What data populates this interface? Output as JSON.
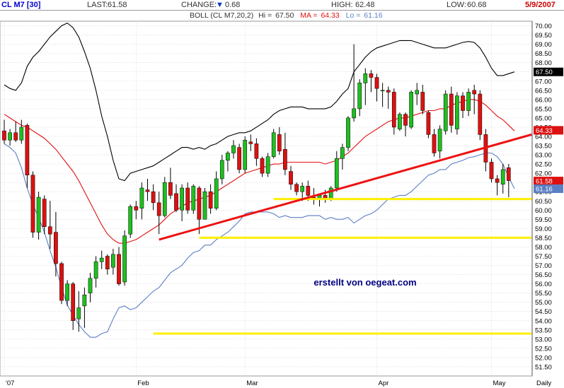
{
  "header": {
    "symbol": "CL M7 [30]",
    "last_label": "LAST:",
    "last_value": "61.58",
    "change_label": "CHANGE:",
    "change_value": "0.68",
    "high_label": "HIGH:",
    "high_value": "62.48",
    "low_label": "LOW:",
    "low_value": "60.68",
    "date": "5/9/2007"
  },
  "legend": {
    "indicator": "BOLL (CL M7,20,2)",
    "hi_label": "Hi =",
    "hi_value": "67.50",
    "ma_label": "MA =",
    "ma_value": "64.33",
    "lo_label": "Lo =",
    "lo_value": "61.16"
  },
  "colors": {
    "up": "#1fbf1f",
    "down": "#dd1111",
    "ma": "#e01010",
    "upper_band": "#000000",
    "lower_band": "#5b7fc4",
    "trendline": "#ee1111",
    "support": "#ffee00",
    "grid": "#c8c8c8",
    "annotation": "#000080"
  },
  "chart_data": {
    "type": "candlestick",
    "y_range": [
      51.0,
      70.25
    ],
    "y_ticks": [
      "51.50",
      "52.00",
      "52.50",
      "53.00",
      "53.50",
      "54.00",
      "54.50",
      "55.00",
      "55.50",
      "56.00",
      "56.50",
      "57.00",
      "57.50",
      "58.00",
      "58.50",
      "59.00",
      "59.50",
      "60.00",
      "60.50",
      "61.00",
      "61.50",
      "62.00",
      "62.50",
      "63.00",
      "63.50",
      "64.00",
      "64.50",
      "65.00",
      "65.50",
      "66.00",
      "66.50",
      "67.00",
      "67.50",
      "68.00",
      "68.50",
      "69.00",
      "69.50",
      "70.00"
    ],
    "x_ticks": [
      "'07",
      "Feb",
      "Mar",
      "Apr",
      "May"
    ],
    "x_axis_label": "Daily",
    "x_tick_positions": [
      0,
      23,
      42,
      65,
      85
    ],
    "candles": [
      [
        64.3,
        64.9,
        63.6,
        63.8
      ],
      [
        63.8,
        64.4,
        63.5,
        64.2
      ],
      [
        64.2,
        64.8,
        63.7,
        63.8
      ],
      [
        63.8,
        64.9,
        63.6,
        64.5
      ],
      [
        64.6,
        64.7,
        61.2,
        61.9
      ],
      [
        61.9,
        62.1,
        58.5,
        58.8
      ],
      [
        58.8,
        61.0,
        58.4,
        60.7
      ],
      [
        60.6,
        60.8,
        58.7,
        59.1
      ],
      [
        59.1,
        60.5,
        57.9,
        58.7
      ],
      [
        58.8,
        59.9,
        56.4,
        57.1
      ],
      [
        57.1,
        57.2,
        54.9,
        55.1
      ],
      [
        55.1,
        56.2,
        54.8,
        56.0
      ],
      [
        56.0,
        56.1,
        53.5,
        54.0
      ],
      [
        54.1,
        55.6,
        53.4,
        54.7
      ],
      [
        54.8,
        55.8,
        53.6,
        55.4
      ],
      [
        55.5,
        56.6,
        55.0,
        56.3
      ],
      [
        56.3,
        57.5,
        55.8,
        57.2
      ],
      [
        57.2,
        57.8,
        56.8,
        57.4
      ],
      [
        57.5,
        57.6,
        56.5,
        56.8
      ],
      [
        56.9,
        57.9,
        56.5,
        57.6
      ],
      [
        57.6,
        58.0,
        55.9,
        56.0
      ],
      [
        56.1,
        58.9,
        55.9,
        58.6
      ],
      [
        58.7,
        60.3,
        58.5,
        60.2
      ],
      [
        60.2,
        60.5,
        59.5,
        60.0
      ],
      [
        60.1,
        61.5,
        59.5,
        61.2
      ],
      [
        61.1,
        61.7,
        60.5,
        61.0
      ],
      [
        61.0,
        61.4,
        60.0,
        60.4
      ],
      [
        60.4,
        61.0,
        58.7,
        59.7
      ],
      [
        59.7,
        61.8,
        59.6,
        61.5
      ],
      [
        61.5,
        62.3,
        60.6,
        60.8
      ],
      [
        60.9,
        61.4,
        59.9,
        60.0
      ],
      [
        60.0,
        61.4,
        59.4,
        61.2
      ],
      [
        61.2,
        61.5,
        59.8,
        60.0
      ],
      [
        60.0,
        61.4,
        59.8,
        61.3
      ],
      [
        61.2,
        61.3,
        58.7,
        59.5
      ],
      [
        59.5,
        61.2,
        59.5,
        61.0
      ],
      [
        61.0,
        61.4,
        59.8,
        60.1
      ],
      [
        60.1,
        62.1,
        60.0,
        61.7
      ],
      [
        61.7,
        63.0,
        61.4,
        62.7
      ],
      [
        62.7,
        63.2,
        62.1,
        63.1
      ],
      [
        63.1,
        63.8,
        62.8,
        63.5
      ],
      [
        63.4,
        63.6,
        62.0,
        62.2
      ],
      [
        62.2,
        64.0,
        62.0,
        63.8
      ],
      [
        63.7,
        64.1,
        63.2,
        63.6
      ],
      [
        63.6,
        63.9,
        62.4,
        62.8
      ],
      [
        62.8,
        62.9,
        61.8,
        62.0
      ],
      [
        62.0,
        63.1,
        61.8,
        62.9
      ],
      [
        62.9,
        64.4,
        62.8,
        64.2
      ],
      [
        64.1,
        64.5,
        63.0,
        63.2
      ],
      [
        63.3,
        64.2,
        61.9,
        62.2
      ],
      [
        62.1,
        62.4,
        61.1,
        61.4
      ],
      [
        61.4,
        61.5,
        60.8,
        61.0
      ],
      [
        61.0,
        61.5,
        60.5,
        61.3
      ],
      [
        61.3,
        61.6,
        60.5,
        60.8
      ],
      [
        60.7,
        61.2,
        60.3,
        60.6
      ],
      [
        60.6,
        60.9,
        60.2,
        60.8
      ],
      [
        60.8,
        61.1,
        60.4,
        60.6
      ],
      [
        60.6,
        61.3,
        60.5,
        61.2
      ],
      [
        61.2,
        63.2,
        61.0,
        62.8
      ],
      [
        62.8,
        63.6,
        62.2,
        63.4
      ],
      [
        63.4,
        65.1,
        63.2,
        65.0
      ],
      [
        65.0,
        69.0,
        64.8,
        65.5
      ],
      [
        65.5,
        67.1,
        65.1,
        66.9
      ],
      [
        66.9,
        67.7,
        65.7,
        67.4
      ],
      [
        67.4,
        67.6,
        66.4,
        67.2
      ],
      [
        67.2,
        67.4,
        65.9,
        66.6
      ],
      [
        66.5,
        66.9,
        65.6,
        66.5
      ],
      [
        66.5,
        66.7,
        65.5,
        66.4
      ],
      [
        66.4,
        66.6,
        64.1,
        64.5
      ],
      [
        64.4,
        65.3,
        64.3,
        65.2
      ],
      [
        65.2,
        65.3,
        64.0,
        64.6
      ],
      [
        64.5,
        66.5,
        64.4,
        66.4
      ],
      [
        66.3,
        66.9,
        65.7,
        66.5
      ],
      [
        66.4,
        66.8,
        65.2,
        65.4
      ],
      [
        65.3,
        65.4,
        63.9,
        64.1
      ],
      [
        64.1,
        64.4,
        62.9,
        63.1
      ],
      [
        63.2,
        64.6,
        62.8,
        64.4
      ],
      [
        64.3,
        66.5,
        64.1,
        66.3
      ],
      [
        66.3,
        66.7,
        64.2,
        64.6
      ],
      [
        64.4,
        66.4,
        64.1,
        66.2
      ],
      [
        66.2,
        66.4,
        65.0,
        65.4
      ],
      [
        65.4,
        66.6,
        65.1,
        66.4
      ],
      [
        66.5,
        66.8,
        65.2,
        66.3
      ],
      [
        66.3,
        66.5,
        63.8,
        64.1
      ],
      [
        64.1,
        64.4,
        62.1,
        62.6
      ],
      [
        62.6,
        62.8,
        61.5,
        61.7
      ],
      [
        61.7,
        61.9,
        60.8,
        61.5
      ],
      [
        61.4,
        62.5,
        60.9,
        62.2
      ],
      [
        62.3,
        62.5,
        60.7,
        61.6
      ]
    ],
    "upper_band": [
      66.8,
      66.6,
      66.5,
      66.9,
      67.8,
      68.3,
      68.6,
      69.0,
      69.4,
      69.7,
      70.0,
      70.15,
      69.9,
      69.4,
      68.6,
      67.7,
      66.5,
      65.1,
      64.0,
      62.7,
      61.7,
      61.6,
      62.0,
      62.1,
      62.2,
      62.3,
      62.4,
      62.6,
      62.8,
      63.0,
      63.2,
      63.4,
      63.4,
      63.3,
      63.4,
      63.3,
      63.5,
      63.6,
      63.8,
      64.0,
      64.1,
      64.2,
      64.2,
      64.3,
      64.5,
      64.7,
      64.9,
      65.2,
      65.4,
      65.5,
      65.6,
      65.6,
      65.6,
      65.5,
      65.5,
      65.5,
      65.5,
      65.6,
      65.9,
      66.3,
      66.6,
      67.5,
      67.9,
      68.3,
      68.6,
      68.8,
      68.9,
      69.0,
      69.1,
      69.2,
      69.2,
      69.2,
      69.1,
      69.0,
      68.9,
      68.8,
      68.8,
      68.8,
      68.9,
      69.0,
      69.1,
      69.15,
      69.1,
      68.8,
      68.3,
      67.7,
      67.3,
      67.3,
      67.4,
      67.5
    ],
    "ma": [
      65.2,
      65.0,
      64.8,
      64.6,
      64.5,
      64.3,
      64.1,
      63.9,
      63.6,
      63.3,
      62.9,
      62.5,
      62.1,
      61.6,
      61.0,
      60.4,
      59.8,
      59.2,
      58.7,
      58.4,
      58.2,
      58.2,
      58.3,
      58.4,
      58.6,
      58.8,
      59.0,
      59.2,
      59.5,
      59.8,
      60.0,
      60.2,
      60.4,
      60.5,
      60.6,
      60.7,
      60.8,
      61.0,
      61.2,
      61.4,
      61.6,
      61.8,
      62.0,
      62.1,
      62.2,
      62.3,
      62.4,
      62.5,
      62.5,
      62.6,
      62.6,
      62.6,
      62.6,
      62.6,
      62.6,
      62.6,
      62.5,
      62.6,
      62.7,
      62.9,
      63.1,
      63.4,
      63.7,
      64.0,
      64.2,
      64.4,
      64.6,
      64.8,
      64.9,
      65.0,
      65.0,
      65.1,
      65.2,
      65.3,
      65.4,
      65.4,
      65.5,
      65.5,
      65.7,
      65.8,
      65.9,
      66.0,
      66.0,
      65.9,
      65.7,
      65.4,
      65.1,
      64.9,
      64.6,
      64.3
    ],
    "lower_band": [
      63.6,
      63.4,
      63.1,
      62.3,
      61.2,
      60.3,
      59.6,
      58.8,
      57.8,
      56.9,
      55.8,
      54.85,
      54.3,
      53.8,
      53.4,
      53.1,
      53.1,
      53.3,
      53.4,
      54.1,
      54.7,
      54.8,
      54.6,
      54.7,
      55.0,
      55.3,
      55.6,
      55.8,
      56.2,
      56.6,
      56.8,
      57.0,
      57.4,
      57.7,
      57.8,
      58.1,
      58.1,
      58.4,
      58.6,
      58.8,
      59.1,
      59.4,
      59.8,
      59.9,
      59.9,
      59.9,
      59.9,
      59.8,
      59.6,
      59.7,
      59.6,
      59.6,
      59.6,
      59.7,
      59.7,
      59.7,
      59.5,
      59.6,
      59.5,
      59.5,
      59.6,
      59.3,
      59.5,
      59.7,
      59.8,
      60.0,
      60.3,
      60.6,
      60.7,
      60.8,
      60.8,
      61.0,
      61.3,
      61.6,
      61.9,
      62.0,
      62.2,
      62.2,
      62.5,
      62.6,
      62.7,
      62.85,
      62.9,
      63.0,
      63.1,
      63.1,
      62.9,
      62.5,
      61.8,
      61.16
    ],
    "trendline": [
      [
        27,
        58.4
      ],
      [
        92,
        64.1
      ]
    ],
    "support_lines": [
      {
        "y": 60.6,
        "from": 47,
        "to": 92
      },
      {
        "y": 58.5,
        "from": 34,
        "to": 92
      },
      {
        "y": 53.3,
        "from": 26,
        "to": 92
      }
    ],
    "price_labels": [
      {
        "text": "67.50",
        "value": 67.5,
        "color": "#000000"
      },
      {
        "text": "64.33",
        "value": 64.33,
        "color": "#dd1111"
      },
      {
        "text": "61.58",
        "value": 61.58,
        "color": "#dd1111"
      },
      {
        "text": "61.16",
        "value": 61.16,
        "color": "#5b7fc4"
      }
    ],
    "annotation": {
      "text": "erstellt von oegeat.com",
      "x": 54,
      "y": 55.9
    }
  }
}
